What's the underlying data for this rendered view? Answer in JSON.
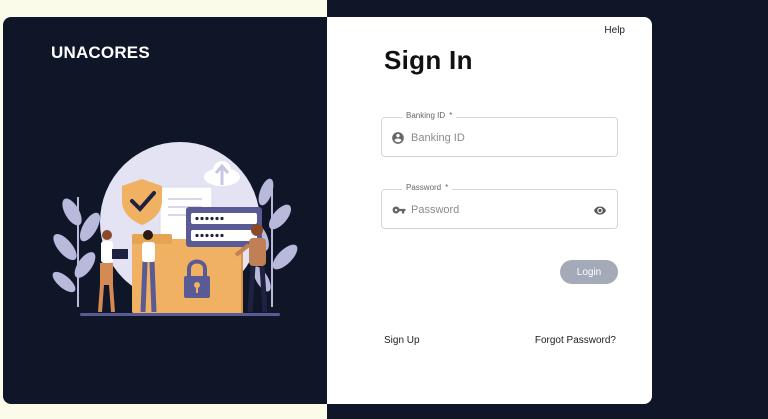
{
  "brand": {
    "logo_text": "UNACORES"
  },
  "header": {
    "help_label": "Help"
  },
  "form": {
    "title": "Sign In",
    "banking_id": {
      "label": "Banking ID",
      "required_mark": "*",
      "placeholder": "Banking ID",
      "value": ""
    },
    "password": {
      "label": "Password",
      "required_mark": "*",
      "placeholder": "Password",
      "value": ""
    },
    "login_label": "Login"
  },
  "links": {
    "sign_up": "Sign Up",
    "forgot_password": "Forgot Password?"
  },
  "colors": {
    "panel_bg": "#0e1628",
    "login_button": "#a5aab8",
    "illustration_purple": "#5a5a94",
    "illustration_orange": "#f0b262"
  },
  "icons": [
    "account-circle-icon",
    "key-icon",
    "eye-icon",
    "shield-check-icon",
    "cloud-upload-icon",
    "padlock-icon",
    "laptop-icon"
  ]
}
